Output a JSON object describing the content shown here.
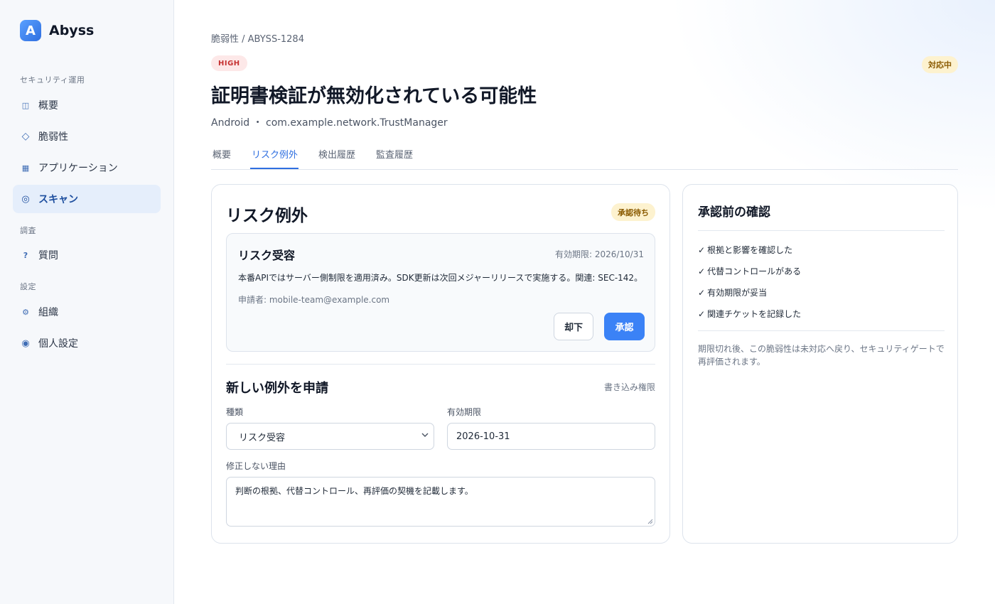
{
  "brand": {
    "logo_letter": "A",
    "name": "Abyss"
  },
  "sidebar": {
    "sections": [
      {
        "title": "セキュリティ運用"
      },
      {
        "title": "調査"
      },
      {
        "title": "設定"
      }
    ],
    "items": [
      {
        "label": "概要",
        "icon": "overview-icon",
        "glyph": "◫"
      },
      {
        "label": "脆弱性",
        "icon": "diamond-icon",
        "glyph": "◇"
      },
      {
        "label": "アプリケーション",
        "icon": "grid-icon",
        "glyph": "▦"
      },
      {
        "label": "スキャン",
        "icon": "scan-icon",
        "glyph": "◎",
        "active": true
      },
      {
        "label": "質問",
        "icon": "question-icon",
        "glyph": "?"
      },
      {
        "label": "組織",
        "icon": "gear-icon",
        "glyph": "⚙"
      },
      {
        "label": "個人設定",
        "icon": "profile-icon",
        "glyph": "◉"
      }
    ]
  },
  "header": {
    "breadcrumb": "脆弱性 / ABYSS-1284",
    "severity": "HIGH",
    "status": "対応中",
    "title": "証明書検証が無効化されている可能性",
    "subtitle": "Android ・ com.example.network.TrustManager"
  },
  "tabs": [
    {
      "label": "概要"
    },
    {
      "label": "リスク例外",
      "active": true
    },
    {
      "label": "検出履歴"
    },
    {
      "label": "監査履歴"
    }
  ],
  "exception_panel": {
    "title": "リスク例外",
    "status_badge": "承認待ち",
    "request": {
      "type": "リスク受容",
      "expiry": "有効期限: 2026/10/31",
      "description": "本番APIではサーバー側制限を適用済み。SDK更新は次回メジャーリリースで実施する。関連: SEC-142。",
      "requester": "申請者: mobile-team@example.com",
      "reject_label": "却下",
      "approve_label": "承認"
    },
    "form": {
      "title": "新しい例外を申請",
      "permission": "書き込み権限",
      "type_label": "種類",
      "type_value": "リスク受容",
      "expiry_label": "有効期限",
      "expiry_value": "2026-10-31",
      "reason_label": "修正しない理由",
      "reason_value": "判断の根拠、代替コントロール、再評価の契機を記載します。"
    }
  },
  "checklist_panel": {
    "title": "承認前の確認",
    "items": [
      "根拠と影響を確認した",
      "代替コントロールがある",
      "有効期限が妥当",
      "関連チケットを記録した"
    ],
    "note": "期限切れ後、この脆弱性は未対応へ戻り、セキュリティゲートで再評価されます。"
  },
  "colors": {
    "accent": "#3b82f6",
    "severity_high_bg": "#fde8e8",
    "severity_high_text": "#c53030",
    "pending_bg": "#fdf2cf",
    "pending_text": "#8a5a00"
  }
}
